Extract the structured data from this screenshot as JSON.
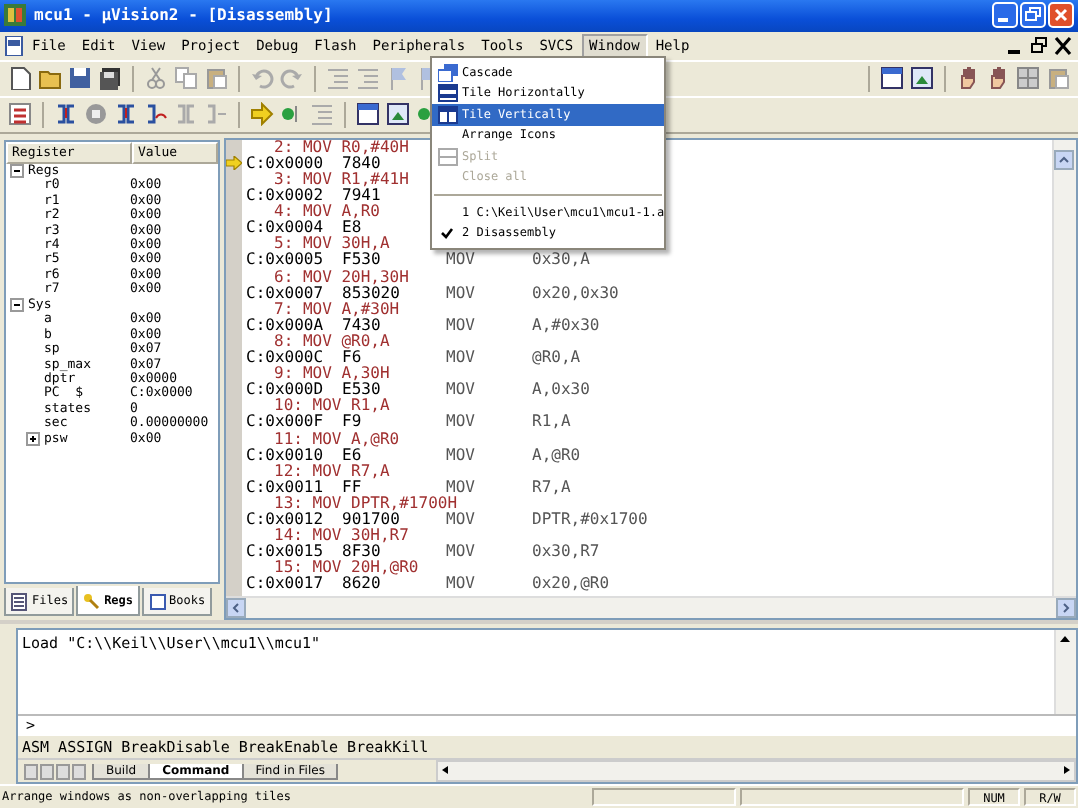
{
  "window": {
    "title": "mcu1 - µVision2 - [Disassembly]"
  },
  "menu": [
    {
      "label": "File",
      "selected": false
    },
    {
      "label": "Edit",
      "selected": false
    },
    {
      "label": "View",
      "selected": false
    },
    {
      "label": "Project",
      "selected": false
    },
    {
      "label": "Debug",
      "selected": false
    },
    {
      "label": "Flash",
      "selected": false
    },
    {
      "label": "Peripherals",
      "selected": false
    },
    {
      "label": "Tools",
      "selected": false
    },
    {
      "label": "SVCS",
      "selected": false
    },
    {
      "label": "Window",
      "selected": true
    },
    {
      "label": "Help",
      "selected": false
    }
  ],
  "window_menu": [
    {
      "kind": "item",
      "label": "Cascade",
      "selected": false,
      "disabled": false,
      "checked": false
    },
    {
      "kind": "item",
      "label": "Tile Horizontally",
      "selected": false,
      "disabled": false,
      "checked": false
    },
    {
      "kind": "item",
      "label": "Tile Vertically",
      "selected": true,
      "disabled": false,
      "checked": false
    },
    {
      "kind": "item",
      "label": "Arrange Icons",
      "selected": false,
      "disabled": false,
      "checked": false
    },
    {
      "kind": "item",
      "label": "Split",
      "selected": false,
      "disabled": true,
      "checked": false
    },
    {
      "kind": "item",
      "label": "Close all",
      "selected": false,
      "disabled": true,
      "checked": false
    },
    {
      "kind": "separator"
    },
    {
      "kind": "item",
      "label": "1 C:\\Keil\\User\\mcu1\\mcu1-1.a",
      "selected": false,
      "disabled": false,
      "checked": false
    },
    {
      "kind": "item",
      "label": "2 Disassembly",
      "selected": false,
      "disabled": false,
      "checked": true
    }
  ],
  "registers": {
    "columns": [
      "Register",
      "Value"
    ],
    "groups": [
      {
        "name": "Regs",
        "expanded": true,
        "children": [
          {
            "name": "r0",
            "value": "0x00"
          },
          {
            "name": "r1",
            "value": "0x00"
          },
          {
            "name": "r2",
            "value": "0x00"
          },
          {
            "name": "r3",
            "value": "0x00"
          },
          {
            "name": "r4",
            "value": "0x00"
          },
          {
            "name": "r5",
            "value": "0x00"
          },
          {
            "name": "r6",
            "value": "0x00"
          },
          {
            "name": "r7",
            "value": "0x00"
          }
        ]
      },
      {
        "name": "Sys",
        "expanded": true,
        "children": [
          {
            "name": "a",
            "value": "0x00"
          },
          {
            "name": "b",
            "value": "0x00"
          },
          {
            "name": "sp",
            "value": "0x07"
          },
          {
            "name": "sp_max",
            "value": "0x07"
          },
          {
            "name": "dptr",
            "value": "0x0000"
          },
          {
            "name": "PC  $",
            "value": "C:0x0000"
          },
          {
            "name": "states",
            "value": "0"
          },
          {
            "name": "sec",
            "value": "0.00000000"
          },
          {
            "name": "psw",
            "value": "0x00",
            "expanded": false
          }
        ]
      }
    ]
  },
  "panel_tabs": [
    {
      "label": "Files",
      "selected": false
    },
    {
      "label": "Regs",
      "selected": true
    },
    {
      "label": "Books",
      "selected": false
    }
  ],
  "disassembly": {
    "lines": [
      {
        "kind": "source",
        "text": "2: MOV R0,#40H"
      },
      {
        "kind": "asm",
        "current": true,
        "address": "C:0x0000",
        "bytes": "7840"
      },
      {
        "kind": "source",
        "text": "3: MOV R1,#41H"
      },
      {
        "kind": "asm",
        "current": false,
        "address": "C:0x0002",
        "bytes": "7941"
      },
      {
        "kind": "source",
        "text": "4: MOV A,R0"
      },
      {
        "kind": "asm",
        "current": false,
        "address": "C:0x0004",
        "bytes": "E8"
      },
      {
        "kind": "source",
        "text": "5: MOV 30H,A"
      },
      {
        "kind": "asm",
        "current": false,
        "address": "C:0x0005",
        "bytes": "F530",
        "mnemonic": "MOV",
        "operands": "0x30,A"
      },
      {
        "kind": "source",
        "text": "6: MOV 20H,30H"
      },
      {
        "kind": "asm",
        "current": false,
        "address": "C:0x0007",
        "bytes": "853020",
        "mnemonic": "MOV",
        "operands": "0x20,0x30"
      },
      {
        "kind": "source",
        "text": "7: MOV A,#30H"
      },
      {
        "kind": "asm",
        "current": false,
        "address": "C:0x000A",
        "bytes": "7430",
        "mnemonic": "MOV",
        "operands": "A,#0x30"
      },
      {
        "kind": "source",
        "text": "8: MOV @R0,A"
      },
      {
        "kind": "asm",
        "current": false,
        "address": "C:0x000C",
        "bytes": "F6",
        "mnemonic": "MOV",
        "operands": "@R0,A"
      },
      {
        "kind": "source",
        "text": "9: MOV A,30H"
      },
      {
        "kind": "asm",
        "current": false,
        "address": "C:0x000D",
        "bytes": "E530",
        "mnemonic": "MOV",
        "operands": "A,0x30"
      },
      {
        "kind": "source",
        "text": "10: MOV R1,A"
      },
      {
        "kind": "asm",
        "current": false,
        "address": "C:0x000F",
        "bytes": "F9",
        "mnemonic": "MOV",
        "operands": "R1,A"
      },
      {
        "kind": "source",
        "text": "11: MOV A,@R0"
      },
      {
        "kind": "asm",
        "current": false,
        "address": "C:0x0010",
        "bytes": "E6",
        "mnemonic": "MOV",
        "operands": "A,@R0"
      },
      {
        "kind": "source",
        "text": "12: MOV R7,A"
      },
      {
        "kind": "asm",
        "current": false,
        "address": "C:0x0011",
        "bytes": "FF",
        "mnemonic": "MOV",
        "operands": "R7,A"
      },
      {
        "kind": "source",
        "text": "13: MOV DPTR,#1700H"
      },
      {
        "kind": "asm",
        "current": false,
        "address": "C:0x0012",
        "bytes": "901700",
        "mnemonic": "MOV",
        "operands": "DPTR,#0x1700"
      },
      {
        "kind": "source",
        "text": "14: MOV 30H,R7"
      },
      {
        "kind": "asm",
        "current": false,
        "address": "C:0x0015",
        "bytes": "8F30",
        "mnemonic": "MOV",
        "operands": "0x30,R7"
      },
      {
        "kind": "source",
        "text": "15: MOV 20H,@R0"
      },
      {
        "kind": "asm",
        "current": false,
        "address": "C:0x0017",
        "bytes": "8620",
        "mnemonic": "MOV",
        "operands": "0x20,@R0"
      }
    ]
  },
  "output": {
    "lines": [
      "Load \"C:\\\\Keil\\\\User\\\\mcu1\\\\mcu1\""
    ],
    "prompt": ">",
    "command_hint": "ASM ASSIGN BreakDisable BreakEnable BreakKill",
    "tabs": [
      {
        "label": "Build",
        "selected": false
      },
      {
        "label": "Command",
        "selected": true
      },
      {
        "label": "Find in Files",
        "selected": false
      }
    ]
  },
  "status_bar": {
    "message": "Arrange windows as non-overlapping tiles",
    "indicators": [
      "NUM",
      "R/W"
    ]
  }
}
